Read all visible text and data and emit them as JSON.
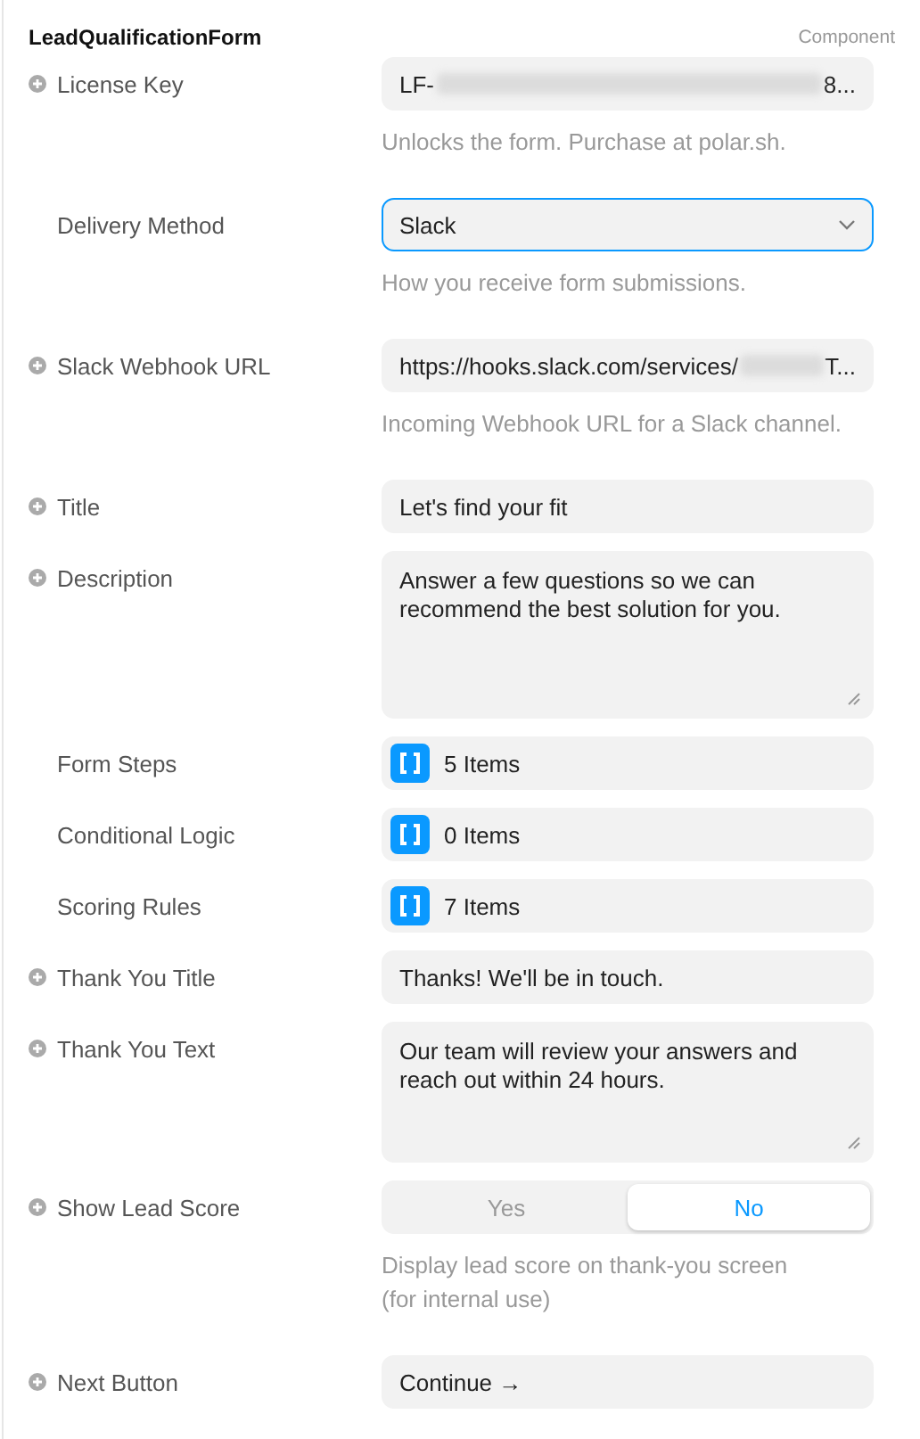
{
  "header": {
    "title": "LeadQualificationForm",
    "badge": "Component"
  },
  "properties": [
    {
      "kind": "text",
      "label": "License Key",
      "addable": true,
      "value": "LF-",
      "redacted": true,
      "value_end": "8...",
      "hint": "Unlocks the form. Purchase at polar.sh."
    },
    {
      "kind": "select",
      "label": "Delivery Method",
      "addable": false,
      "value": "Slack",
      "focused": true,
      "hint": "How you receive form submissions."
    },
    {
      "kind": "text",
      "label": "Slack Webhook URL",
      "addable": true,
      "value": "https://hooks.slack.com/services/",
      "redacted": true,
      "value_end": "T...",
      "hint": "Incoming Webhook URL for a Slack channel."
    },
    {
      "kind": "text",
      "label": "Title",
      "addable": true,
      "value": "Let's find your fit"
    },
    {
      "kind": "textarea",
      "label": "Description",
      "addable": true,
      "value": "Answer a few questions so we can recommend the best solution for you."
    },
    {
      "kind": "array",
      "label": "Form Steps",
      "addable": false,
      "value": "5 Items"
    },
    {
      "kind": "array",
      "label": "Conditional Logic",
      "addable": false,
      "value": "0 Items"
    },
    {
      "kind": "array",
      "label": "Scoring Rules",
      "addable": false,
      "value": "7 Items"
    },
    {
      "kind": "text",
      "label": "Thank You Title",
      "addable": true,
      "value": "Thanks! We'll be in touch."
    },
    {
      "kind": "textarea",
      "label": "Thank You Text",
      "addable": true,
      "value": "Our team will review your answers and reach out within 24 hours."
    },
    {
      "kind": "toggle",
      "label": "Show Lead Score",
      "addable": true,
      "options": [
        {
          "label": "Yes",
          "selected": false
        },
        {
          "label": "No",
          "selected": true
        }
      ],
      "hint": "Display lead score on thank-you screen (for internal use)"
    },
    {
      "kind": "text",
      "label": "Next Button",
      "addable": true,
      "value": "Continue →"
    }
  ]
}
